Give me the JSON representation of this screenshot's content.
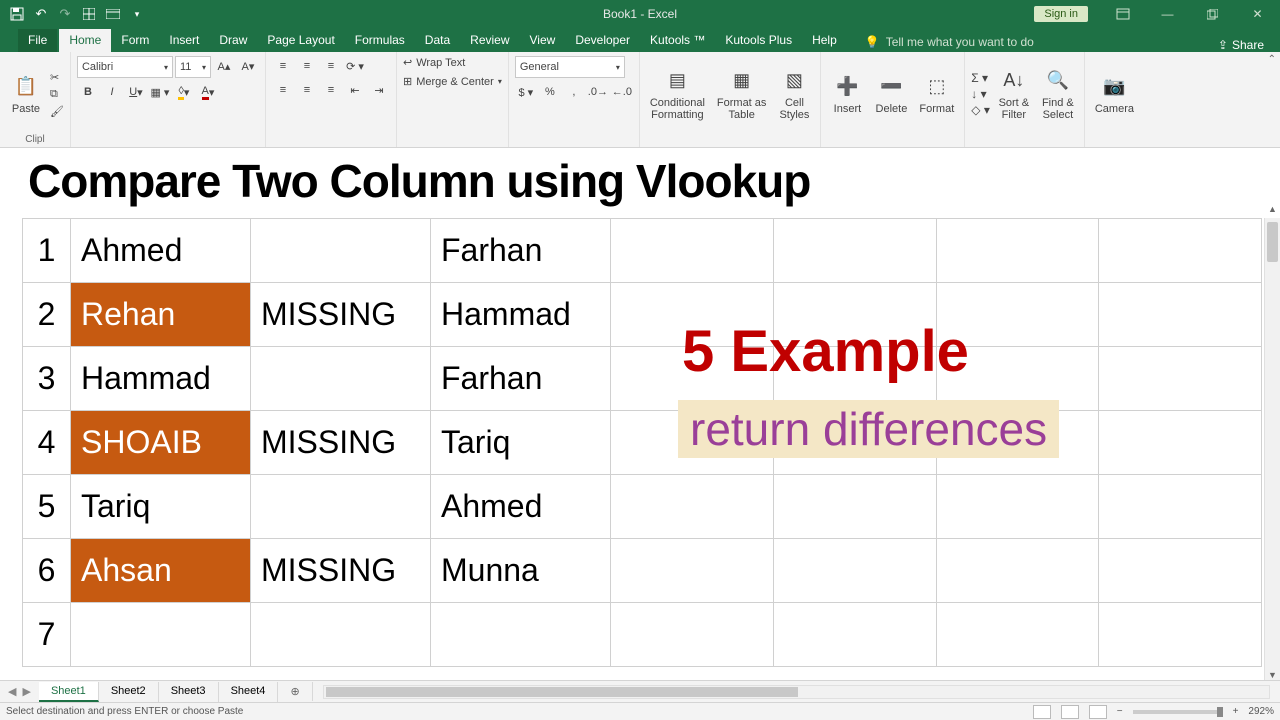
{
  "app": {
    "title": "Book1 - Excel",
    "signin": "Sign in",
    "share": "Share"
  },
  "tabs": {
    "file": "File",
    "items": [
      "Home",
      "Form",
      "Insert",
      "Draw",
      "Page Layout",
      "Formulas",
      "Data",
      "Review",
      "View",
      "Developer",
      "Kutools ™",
      "Kutools Plus",
      "Help"
    ],
    "active": "Home",
    "tellme": "Tell me what you want to do"
  },
  "ribbon": {
    "paste": "Paste",
    "clipboard": "Clipl",
    "font_name": "Calibri",
    "font_size": "11",
    "wrap": "Wrap Text",
    "merge": "Merge & Center",
    "numfmt": "General",
    "cond": "Conditional\nFormatting",
    "fmtTable": "Format as\nTable",
    "cellStyles": "Cell\nStyles",
    "insert": "Insert",
    "delete": "Delete",
    "format": "Format",
    "sort": "Sort &\nFilter",
    "find": "Find &\nSelect",
    "camera": "Camera"
  },
  "overlay": {
    "title": "Compare Two Column using Vlookup",
    "annot1": "5 Example",
    "annot2": "return differences"
  },
  "sheet": {
    "rows": [
      {
        "n": "1",
        "a": "Ahmed",
        "b": "",
        "c": "Farhan",
        "mark": false
      },
      {
        "n": "2",
        "a": "Rehan",
        "b": "MISSING",
        "c": "Hammad",
        "mark": true
      },
      {
        "n": "3",
        "a": "Hammad",
        "b": "",
        "c": "Farhan",
        "mark": false
      },
      {
        "n": "4",
        "a": "SHOAIB",
        "b": "MISSING",
        "c": "Tariq",
        "mark": true
      },
      {
        "n": "5",
        "a": "Tariq",
        "b": "",
        "c": "Ahmed",
        "mark": false
      },
      {
        "n": "6",
        "a": "Ahsan",
        "b": "MISSING",
        "c": "Munna",
        "mark": true
      },
      {
        "n": "7",
        "a": "",
        "b": "",
        "c": "",
        "mark": false
      }
    ]
  },
  "sheetTabs": {
    "items": [
      "Sheet1",
      "Sheet2",
      "Sheet3",
      "Sheet4"
    ],
    "active": "Sheet1"
  },
  "status": {
    "msg": "Select destination and press ENTER or choose Paste",
    "zoom": "292%"
  }
}
